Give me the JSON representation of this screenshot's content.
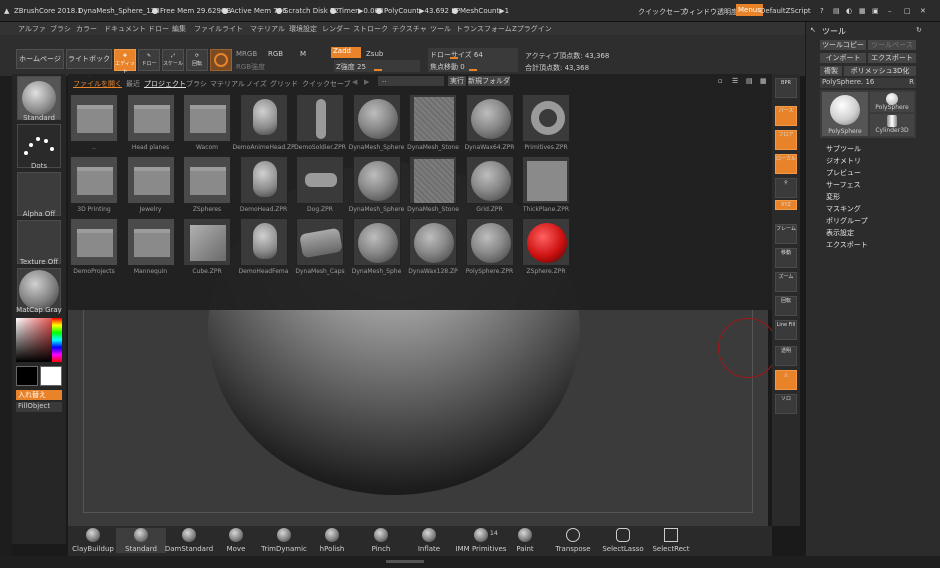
{
  "titlebar": {
    "app": "ZBrushCore 2018.1",
    "project": "DynaMesh_Sphere_128",
    "free_mem": "Free Mem 29.629GB",
    "active_mem": "Active Mem 706",
    "scratch": "Scratch Disk 72",
    "timer": "Timer▶0.008",
    "polycount": "PolyCount▶43.692 KP",
    "meshcount": "MeshCount▶1",
    "quicksave": "クイックセーブ",
    "transparency": "ウィンドウ透明度",
    "menus": "Menus",
    "zscript": "DefaultZScript"
  },
  "menubar": [
    "アルファ",
    "ブラシ",
    "カラー",
    "ドキュメント",
    "ドロー",
    "編集",
    "ファイル",
    "ライト",
    "マテリアル",
    "環境設定",
    "レンダー",
    "ストローク",
    "テクスチャ",
    "ツール",
    "トランスフォーム",
    "Zプラグイン"
  ],
  "toolbar": {
    "home": "ホームページ",
    "lightbox": "ライトボックス",
    "edit": "エディット",
    "draw": "ドロー",
    "scale": "スケール",
    "rotate": "回転",
    "mrgb": "MRGB",
    "rgb": "RGB",
    "m": "M",
    "rgb_intensity": "RGB強度",
    "zadd": "Zadd",
    "zsub": "Zsub",
    "z_intensity": "Z強度 25",
    "draw_size": "ドローサイズ 64",
    "focal_shift": "焦点移動 0",
    "active_points": "アクティブ頂点数: 43,368",
    "total_points": "合計頂点数: 43,368"
  },
  "leftshelf": {
    "brush": "Standard",
    "stroke": "Dots",
    "alpha": "Alpha Off",
    "texture": "Texture Off",
    "material": "MatCap Gray",
    "swap": "入れ替え",
    "fill": "FillObject"
  },
  "lightbox": {
    "tabs": [
      "ファイルを開く",
      "最近",
      "プロジェクト",
      "ブラシ",
      "マテリアル",
      "ノイズ",
      "グリッド",
      "クイックセーブ"
    ],
    "path_value": "..",
    "run": "実行",
    "new_folder": "新規フォルダ",
    "items": [
      {
        "label": "..",
        "kind": "folder"
      },
      {
        "label": "Head planes",
        "kind": "folder"
      },
      {
        "label": "Wacom",
        "kind": "folder"
      },
      {
        "label": "DemoAnimeHead.ZPR",
        "kind": "head"
      },
      {
        "label": "DemoSoldier.ZPR",
        "kind": "body"
      },
      {
        "label": "DynaMesh_Sphere",
        "kind": "ball"
      },
      {
        "label": "DynaMesh_Stone",
        "kind": "texture"
      },
      {
        "label": "DynaWax64.ZPR",
        "kind": "ball"
      },
      {
        "label": "Primitives.ZPR",
        "kind": "tube"
      },
      {
        "label": "3D Printing",
        "kind": "folder"
      },
      {
        "label": "Jewelry",
        "kind": "folder"
      },
      {
        "label": "ZSpheres",
        "kind": "folder"
      },
      {
        "label": "DemoHead.ZPR",
        "kind": "head"
      },
      {
        "label": "Dog.ZPR",
        "kind": "dog"
      },
      {
        "label": "DynaMesh_Sphere",
        "kind": "ball"
      },
      {
        "label": "DynaMesh_Stone",
        "kind": "texture"
      },
      {
        "label": "Grid.ZPR",
        "kind": "ball"
      },
      {
        "label": "ThickPlane.ZPR",
        "kind": "plane"
      },
      {
        "label": "DemoProjects",
        "kind": "folder"
      },
      {
        "label": "Mannequin",
        "kind": "folder"
      },
      {
        "label": "Cube.ZPR",
        "kind": "cube"
      },
      {
        "label": "DemoHeadFema",
        "kind": "head"
      },
      {
        "label": "DynaMesh_Caps",
        "kind": "capsule"
      },
      {
        "label": "DynaMesh_Sphe",
        "kind": "ball"
      },
      {
        "label": "DynaWax128.ZP",
        "kind": "ball"
      },
      {
        "label": "PolySphere.ZPR",
        "kind": "ball"
      },
      {
        "label": "ZSphere.ZPR",
        "kind": "red"
      }
    ]
  },
  "rightshelf": [
    {
      "name": "bpr",
      "label": "BPR"
    },
    {
      "name": "perspective",
      "label": "パース"
    },
    {
      "name": "floor",
      "label": "フロア"
    },
    {
      "name": "local",
      "label": "ローカル"
    },
    {
      "name": "xyz",
      "label": "XYZ"
    },
    {
      "name": "frame",
      "label": "フレーム"
    },
    {
      "name": "move",
      "label": "移動"
    },
    {
      "name": "zoom",
      "label": "ズーム"
    },
    {
      "name": "rotate",
      "label": "回転"
    },
    {
      "name": "linefill",
      "label": "Line Fill"
    },
    {
      "name": "transp",
      "label": "透明"
    },
    {
      "name": "solo",
      "label": "ソロ"
    }
  ],
  "toolpanel": {
    "title": "ツール",
    "copy": "ツールコピー",
    "paste": "ツールペースト",
    "import": "インポート",
    "export": "エクスポート",
    "duplicate": "複製",
    "polymesh": "ポリメッシュ3D化",
    "current": "PolySphere. 16",
    "r": "R",
    "tool1": "PolySphere",
    "tool2": "PolySphere",
    "tool3": "Cylinder3D",
    "sections": [
      "サブツール",
      "ジオメトリ",
      "プレビュー",
      "サーフェス",
      "変形",
      "マスキング",
      "ポリグループ",
      "表示設定",
      "エクスポート"
    ]
  },
  "bottombar": {
    "brushes": [
      "ClayBuildup",
      "Standard",
      "DamStandard",
      "Move",
      "TrimDynamic",
      "hPolish",
      "Pinch",
      "Inflate",
      "IMM Primitives",
      "Paint",
      "Transpose",
      "SelectLasso",
      "SelectRect"
    ],
    "imm_count": "14"
  },
  "colors": {
    "accent": "#e8832a",
    "bg": "#2c2c2c",
    "zsphere": "#cc1111"
  }
}
